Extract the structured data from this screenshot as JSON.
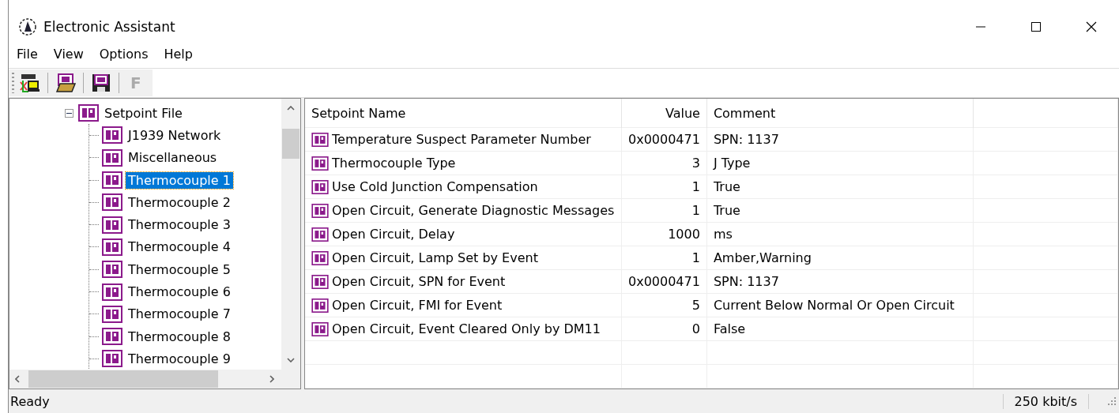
{
  "window": {
    "title": "Electronic Assistant"
  },
  "menu": [
    "File",
    "View",
    "Options",
    "Help"
  ],
  "toolbar": [
    {
      "kind": "can",
      "disabled": false
    },
    {
      "kind": "open",
      "disabled": false
    },
    {
      "kind": "save",
      "disabled": false
    },
    {
      "kind": "text",
      "label": "F",
      "disabled": true
    }
  ],
  "tree": {
    "label": "Setpoint File",
    "expanded": true,
    "children": [
      {
        "label": "J1939 Network",
        "selected": false
      },
      {
        "label": "Miscellaneous",
        "selected": false
      },
      {
        "label": "Thermocouple 1",
        "selected": true
      },
      {
        "label": "Thermocouple 2",
        "selected": false
      },
      {
        "label": "Thermocouple 3",
        "selected": false
      },
      {
        "label": "Thermocouple 4",
        "selected": false
      },
      {
        "label": "Thermocouple 5",
        "selected": false
      },
      {
        "label": "Thermocouple 6",
        "selected": false
      },
      {
        "label": "Thermocouple 7",
        "selected": false
      },
      {
        "label": "Thermocouple 8",
        "selected": false
      },
      {
        "label": "Thermocouple 9",
        "selected": false
      }
    ]
  },
  "table": {
    "columns": [
      "Setpoint Name",
      "Value",
      "Comment"
    ],
    "rows": [
      {
        "name": "Temperature Suspect Parameter Number",
        "value": "0x0000471",
        "comment": "SPN: 1137"
      },
      {
        "name": "Thermocouple Type",
        "value": "3",
        "comment": "J Type"
      },
      {
        "name": "Use Cold Junction Compensation",
        "value": "1",
        "comment": "True"
      },
      {
        "name": "Open Circuit, Generate Diagnostic Messages",
        "value": "1",
        "comment": "True"
      },
      {
        "name": "Open Circuit, Delay",
        "value": "1000",
        "comment": "ms"
      },
      {
        "name": "Open Circuit, Lamp Set by Event",
        "value": "1",
        "comment": "Amber,Warning"
      },
      {
        "name": "Open Circuit, SPN for Event",
        "value": "0x0000471",
        "comment": "SPN: 1137"
      },
      {
        "name": "Open Circuit, FMI for Event",
        "value": "5",
        "comment": "Current Below Normal Or Open Circuit"
      },
      {
        "name": "Open Circuit, Event Cleared Only by DM11",
        "value": "0",
        "comment": "False"
      }
    ]
  },
  "status_bar": {
    "message": "Ready",
    "baud": "250 kbit/s"
  }
}
